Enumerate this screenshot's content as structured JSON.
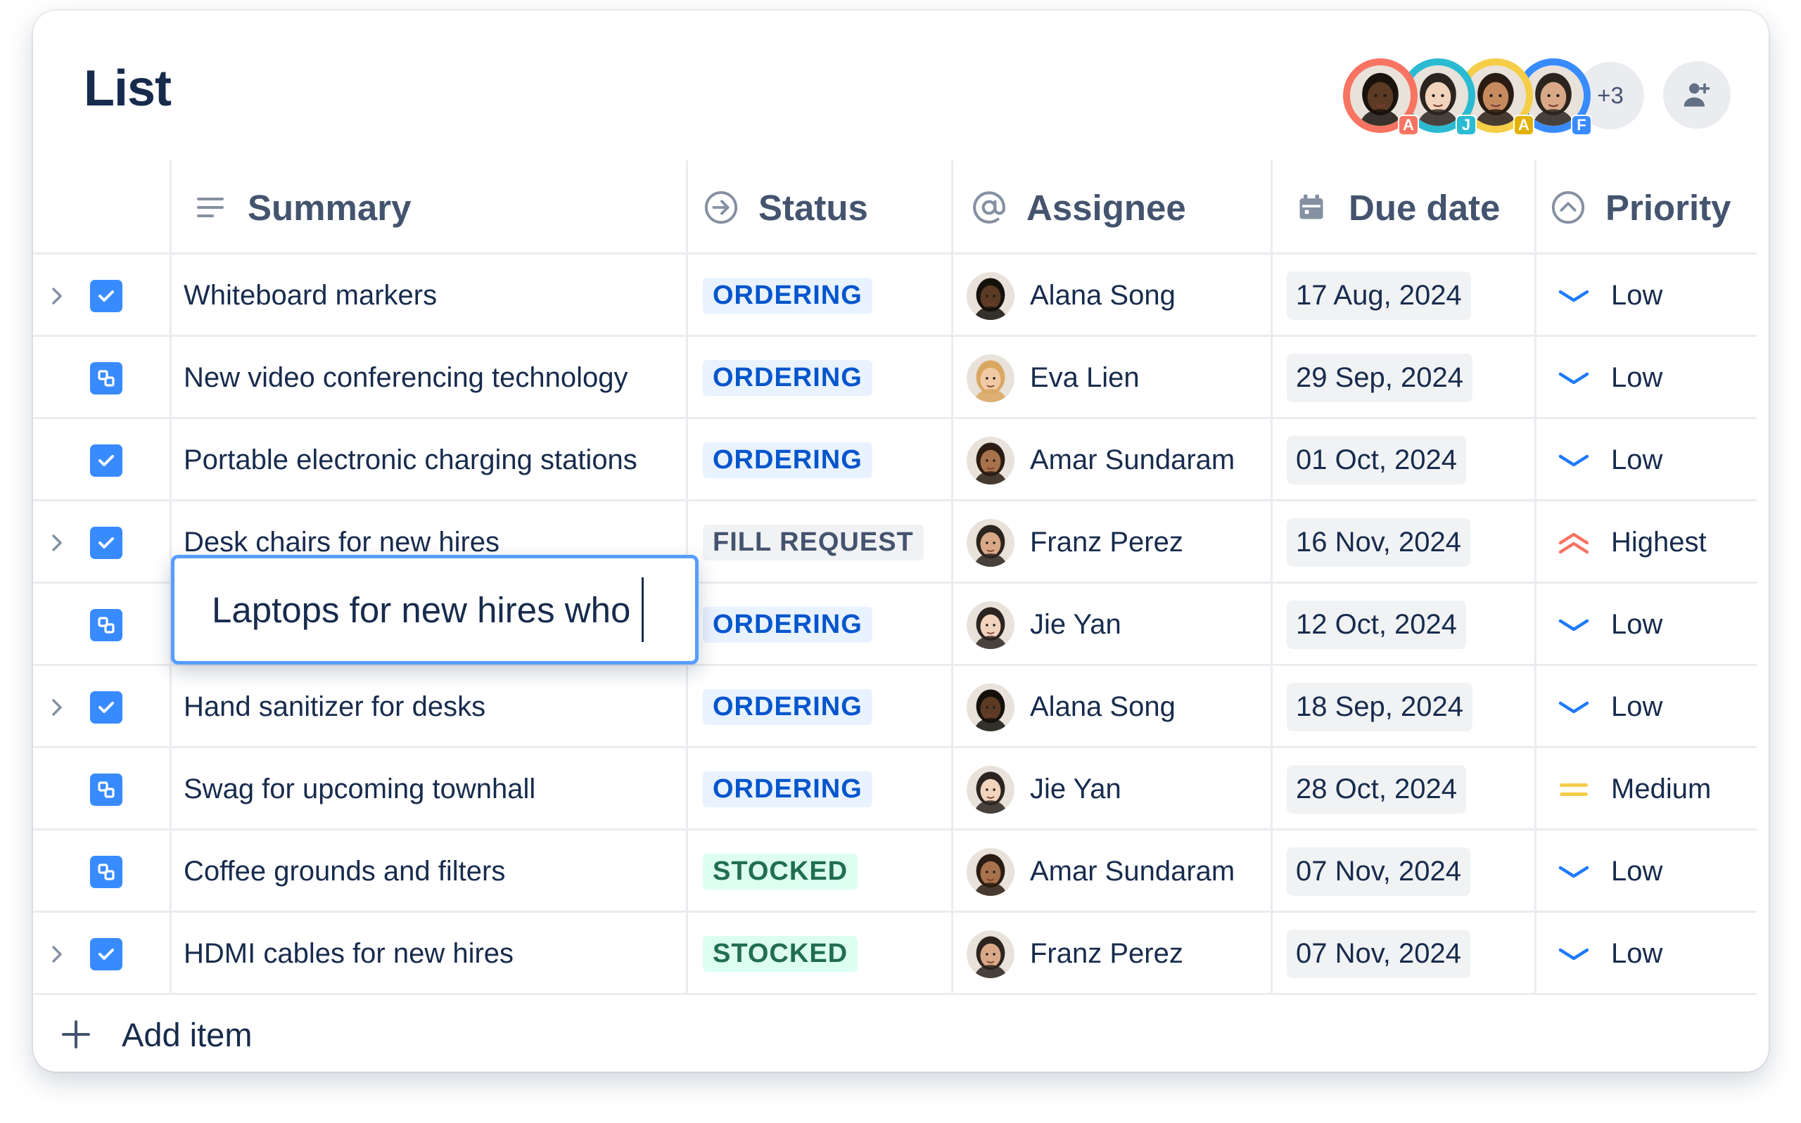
{
  "page": {
    "title": "List"
  },
  "collaborators": {
    "avatars": [
      {
        "initial": "A",
        "ring": "#F87462",
        "badge": "#F87462",
        "skin": "#5C3A24",
        "hair": "#1A120C"
      },
      {
        "initial": "J",
        "ring": "#2ABBD2",
        "badge": "#2ABBD2",
        "skin": "#F2D3BC",
        "hair": "#2B2420"
      },
      {
        "initial": "A",
        "ring": "#F5CD47",
        "badge": "#E2B203",
        "skin": "#C58A5E",
        "hair": "#2A1C12"
      },
      {
        "initial": "F",
        "ring": "#388BFF",
        "badge": "#388BFF",
        "skin": "#D9A987",
        "hair": "#2C241E"
      }
    ],
    "more_count": "+3"
  },
  "columns": {
    "summary": "Summary",
    "status": "Status",
    "assignee": "Assignee",
    "due_date": "Due date",
    "priority": "Priority"
  },
  "rows": [
    {
      "expandable": true,
      "type": "task",
      "summary": "Whiteboard markers",
      "status": "ORDERING",
      "status_kind": "ordering",
      "assignee": "Alana Song",
      "due": "17 Aug, 2024",
      "priority": "Low"
    },
    {
      "expandable": false,
      "type": "subtask",
      "summary": "New video conferencing technology",
      "status": "ORDERING",
      "status_kind": "ordering",
      "assignee": "Eva Lien",
      "due": "29 Sep, 2024",
      "priority": "Low"
    },
    {
      "expandable": false,
      "type": "task",
      "summary": "Portable electronic charging stations",
      "status": "ORDERING",
      "status_kind": "ordering",
      "assignee": "Amar Sundaram",
      "due": "01 Oct, 2024",
      "priority": "Low"
    },
    {
      "expandable": true,
      "type": "task",
      "summary": "Desk chairs for new hires",
      "status": "FILL REQUEST",
      "status_kind": "neutral",
      "assignee": "Franz Perez",
      "due": "16 Nov, 2024",
      "priority": "Highest"
    },
    {
      "expandable": false,
      "type": "subtask",
      "summary": "",
      "status": "ORDERING",
      "status_kind": "ordering",
      "assignee": "Jie Yan",
      "due": "12 Oct, 2024",
      "priority": "Low"
    },
    {
      "expandable": true,
      "type": "task",
      "summary": "Hand sanitizer for desks",
      "status": "ORDERING",
      "status_kind": "ordering",
      "assignee": "Alana Song",
      "due": "18 Sep, 2024",
      "priority": "Low"
    },
    {
      "expandable": false,
      "type": "subtask",
      "summary": "Swag for upcoming townhall",
      "status": "ORDERING",
      "status_kind": "ordering",
      "assignee": "Jie Yan",
      "due": "28 Oct, 2024",
      "priority": "Medium"
    },
    {
      "expandable": false,
      "type": "subtask",
      "summary": "Coffee grounds and filters",
      "status": "STOCKED",
      "status_kind": "stocked",
      "assignee": "Amar Sundaram",
      "due": "07 Nov, 2024",
      "priority": "Low"
    },
    {
      "expandable": true,
      "type": "task",
      "summary": "HDMI cables for new hires",
      "status": "STOCKED",
      "status_kind": "stocked",
      "assignee": "Franz Perez",
      "due": "07 Nov, 2024",
      "priority": "Low"
    }
  ],
  "editor": {
    "value": "Laptops for new hires who"
  },
  "add_item": {
    "label": "Add item"
  },
  "colors": {
    "ordering_bg": "#E9F2FF",
    "ordering_fg": "#0055CC",
    "neutral_bg": "#F1F2F4",
    "neutral_fg": "#44546F",
    "stocked_bg": "#DCFFF1",
    "stocked_fg": "#216E4E",
    "low": "#1D7AFC",
    "highest": "#F87462",
    "medium": "#F5CD47"
  },
  "person_skin": {
    "Alana Song": {
      "skin": "#5C3A24",
      "hair": "#14100C"
    },
    "Eva Lien": {
      "skin": "#F1C9A5",
      "hair": "#D9A760"
    },
    "Amar Sundaram": {
      "skin": "#A8724C",
      "hair": "#2A1C12"
    },
    "Franz Perez": {
      "skin": "#D9A987",
      "hair": "#2C241E"
    },
    "Jie Yan": {
      "skin": "#F2D3BC",
      "hair": "#2B2420"
    }
  },
  "icons": {
    "summary": "lines-icon",
    "status": "arrow-circle-icon",
    "assignee": "at-icon",
    "due_date": "calendar-icon",
    "priority": "chevron-circle-icon",
    "invite": "add-person-icon",
    "add": "plus-icon"
  }
}
